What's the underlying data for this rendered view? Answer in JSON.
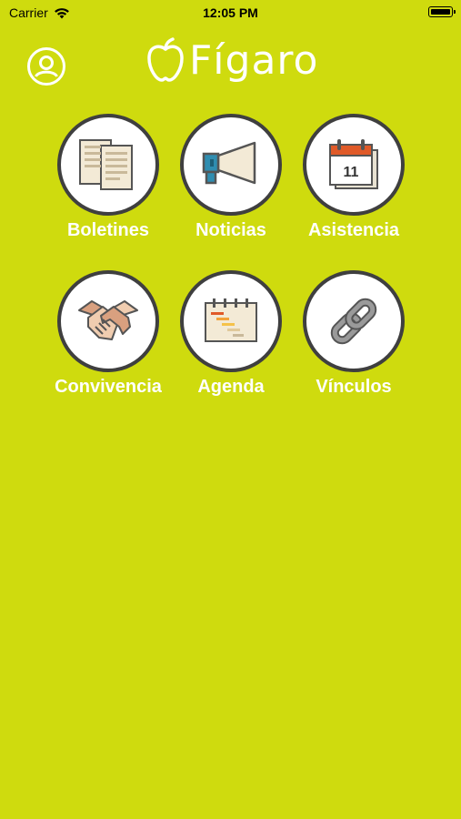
{
  "status_bar": {
    "carrier": "Carrier",
    "time": "12:05 PM"
  },
  "header": {
    "logo_text": "Fígaro",
    "profile_icon": "user-circle-icon"
  },
  "menu": [
    {
      "label": "Boletines",
      "icon": "document-icon"
    },
    {
      "label": "Noticias",
      "icon": "megaphone-icon"
    },
    {
      "label": "Asistencia",
      "icon": "calendar-icon",
      "icon_text": "11"
    },
    {
      "label": "Convivencia",
      "icon": "handshake-icon"
    },
    {
      "label": "Agenda",
      "icon": "gantt-calendar-icon"
    },
    {
      "label": "Vínculos",
      "icon": "chain-link-icon"
    }
  ],
  "colors": {
    "background": "#cfdb0e",
    "circle_border": "#3f3f3f",
    "text": "#ffffff"
  }
}
